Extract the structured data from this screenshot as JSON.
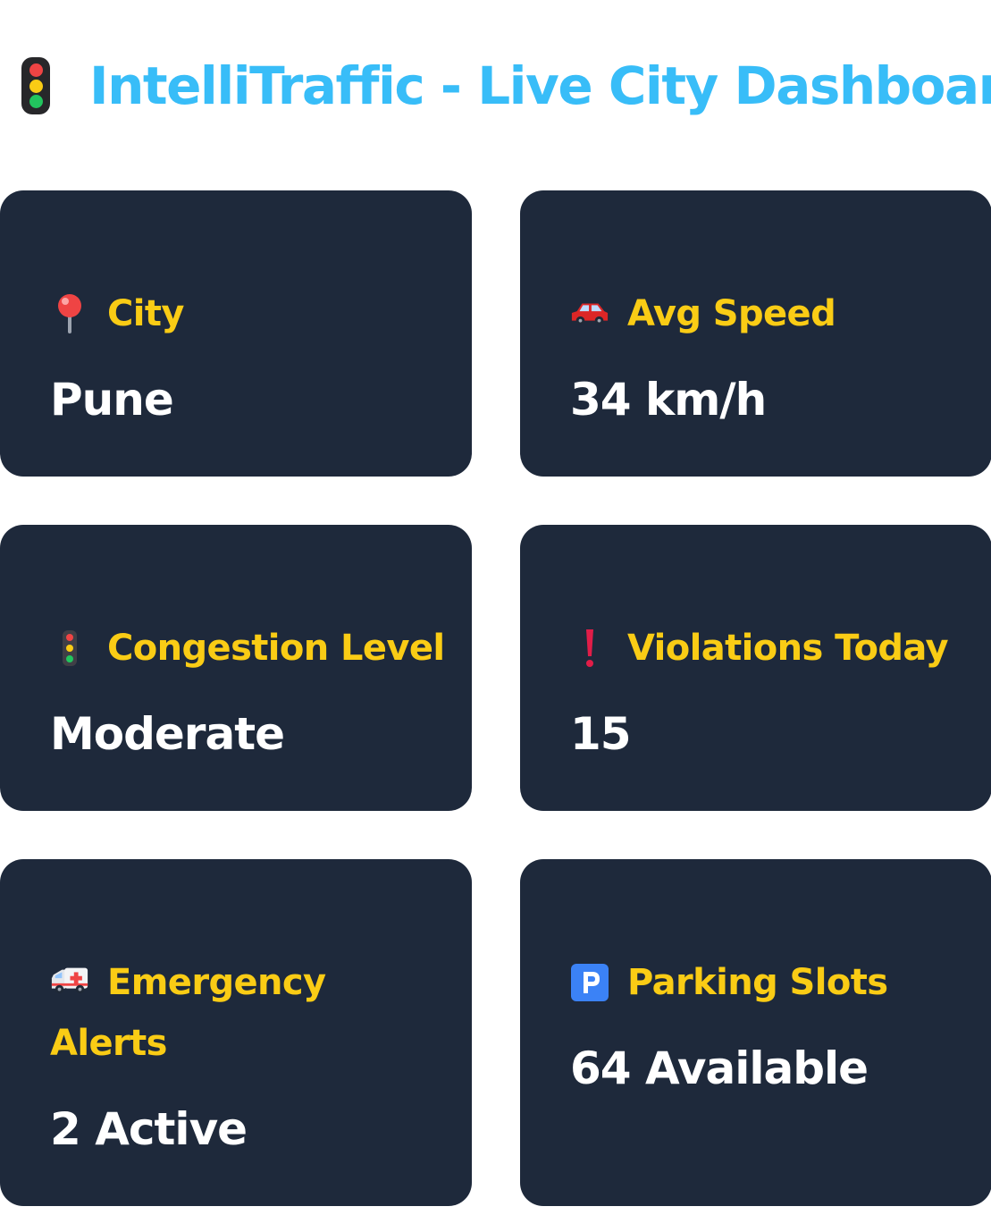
{
  "header": {
    "icon": "traffic-light-icon",
    "title": "IntelliTraffic - Live City Dashboard"
  },
  "colors": {
    "title": "#38bdf8",
    "card_background": "#1e293b",
    "label": "#facc15",
    "value": "#ffffff"
  },
  "cards": [
    {
      "icon": "round-pushpin-icon",
      "label": "City",
      "value": "Pune"
    },
    {
      "icon": "car-icon",
      "label": "Avg Speed",
      "value": "34 km/h"
    },
    {
      "icon": "traffic-light-icon",
      "label": "Congestion Level",
      "value": "Moderate"
    },
    {
      "icon": "exclamation-icon",
      "label": "Violations Today",
      "value": "15"
    },
    {
      "icon": "ambulance-icon",
      "label": "Emergency Alerts",
      "value": "2 Active"
    },
    {
      "icon": "parking-icon",
      "label": "Parking Slots",
      "value": "64 Available"
    }
  ]
}
